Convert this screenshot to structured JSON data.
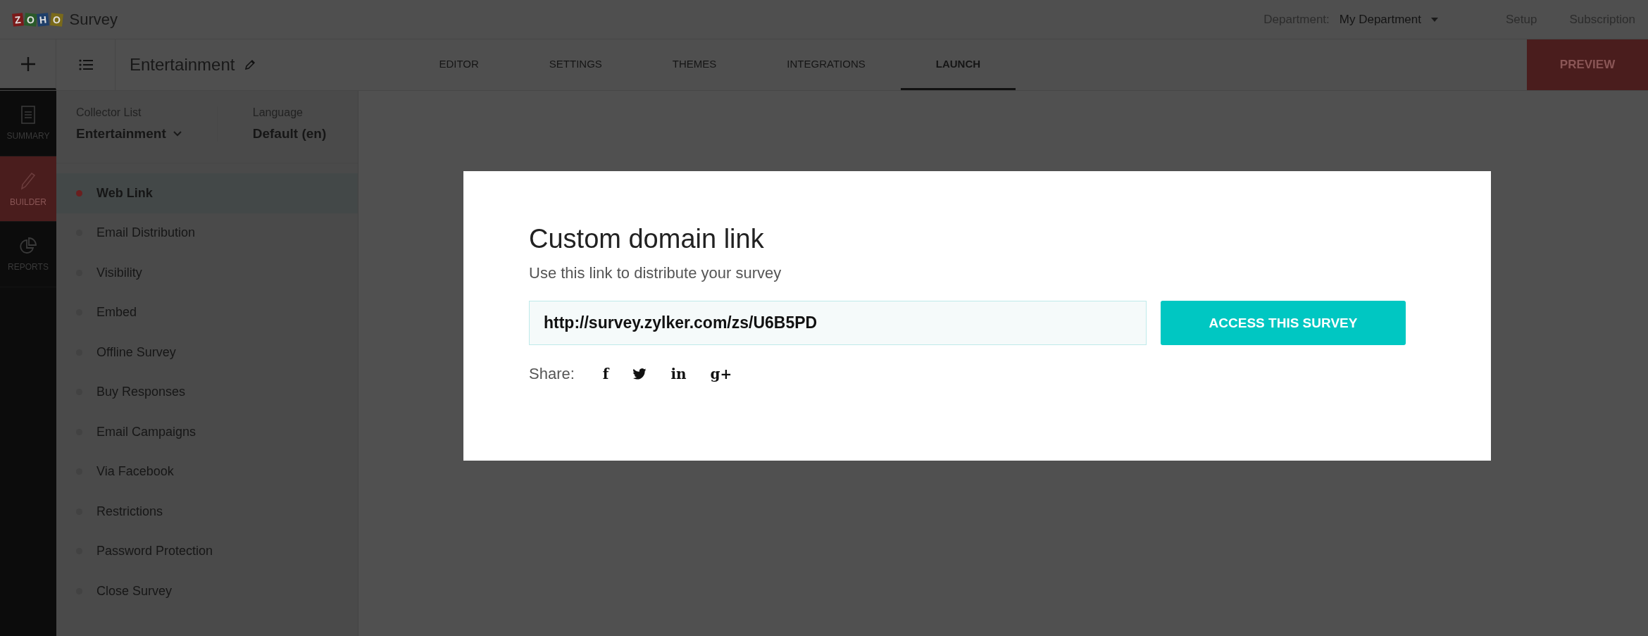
{
  "header": {
    "logo": {
      "letters": [
        {
          "char": "Z",
          "color": "#7a1a1a"
        },
        {
          "char": "O",
          "color": "#2a5a2a"
        },
        {
          "char": "H",
          "color": "#1f3f6a"
        },
        {
          "char": "O",
          "color": "#7a6a1a"
        }
      ],
      "product": "Survey"
    },
    "department_label": "Department:",
    "department": "My Department",
    "links": [
      "Setup",
      "Subscription"
    ]
  },
  "toolbar": {
    "survey_title": "Entertainment",
    "tabs": [
      {
        "label": "EDITOR",
        "selected": false
      },
      {
        "label": "SETTINGS",
        "selected": false
      },
      {
        "label": "THEMES",
        "selected": false
      },
      {
        "label": "INTEGRATIONS",
        "selected": false
      },
      {
        "label": "LAUNCH",
        "selected": true
      }
    ],
    "preview_button": "PREVIEW"
  },
  "nav_rail": [
    {
      "label": "SUMMARY",
      "selected": false
    },
    {
      "label": "BUILDER",
      "selected": true
    },
    {
      "label": "REPORTS",
      "selected": false
    }
  ],
  "sidebar": {
    "collector_label": "Collector List",
    "collector": "Entertainment",
    "language_label": "Language",
    "language": "Default (en)",
    "items": [
      {
        "label": "Web Link",
        "selected": true
      },
      {
        "label": "Email Distribution",
        "selected": false
      },
      {
        "label": "Visibility",
        "selected": false
      },
      {
        "label": "Embed",
        "selected": false
      },
      {
        "label": "Offline Survey",
        "selected": false
      },
      {
        "label": "Buy Responses",
        "selected": false
      },
      {
        "label": "Email Campaigns",
        "selected": false
      },
      {
        "label": "Via Facebook",
        "selected": false
      },
      {
        "label": "Restrictions",
        "selected": false
      },
      {
        "label": "Password Protection",
        "selected": false
      },
      {
        "label": "Close Survey",
        "selected": false
      }
    ]
  },
  "dialog": {
    "title": "Custom domain link",
    "subtitle": "Use this link to distribute your survey",
    "link": "http://survey.zylker.com/zs/U6B5PD",
    "access_button": "ACCESS THIS SURVEY",
    "share_label": "Share:",
    "share_buttons": [
      {
        "kind": "text",
        "label": "f"
      },
      {
        "kind": "bird"
      },
      {
        "kind": "text",
        "label": "in"
      },
      {
        "kind": "text",
        "label": "g+"
      }
    ]
  }
}
